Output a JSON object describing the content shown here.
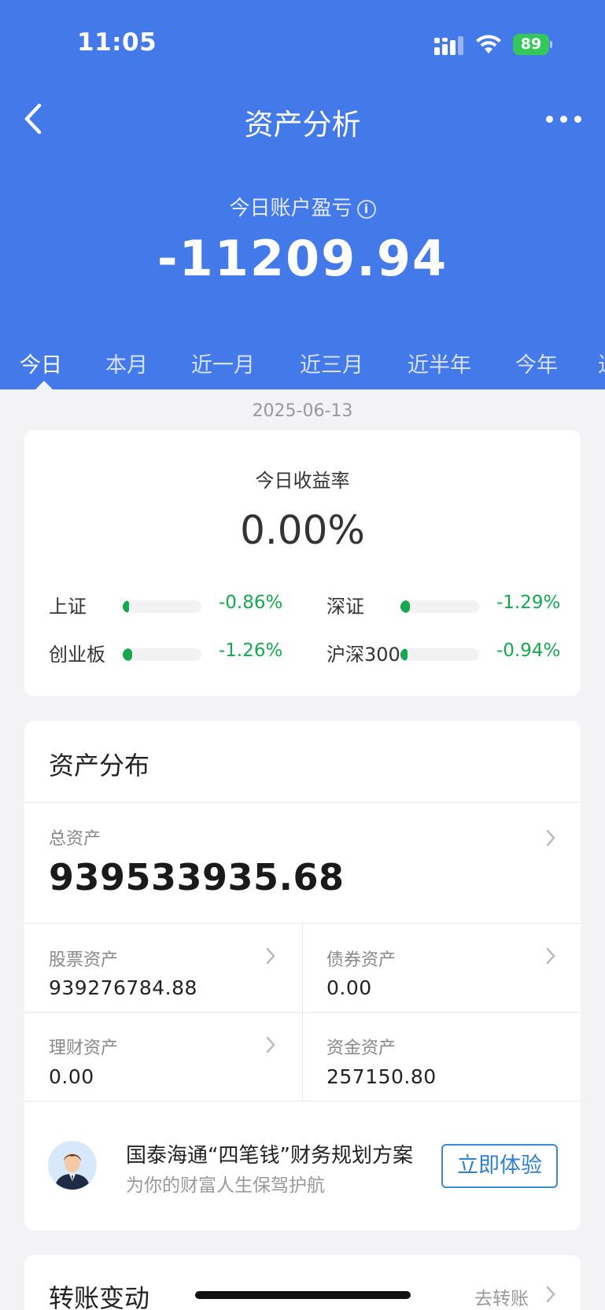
{
  "status_bar": {
    "time": "11:05",
    "battery": "89"
  },
  "nav": {
    "title": "资产分析"
  },
  "pl": {
    "label": "今日账户盈亏",
    "value": "-11209.94"
  },
  "tabs": [
    "今日",
    "本月",
    "近一月",
    "近三月",
    "近半年",
    "今年",
    "近"
  ],
  "date": "2025-06-13",
  "rate_card": {
    "label": "今日收益率",
    "value": "0.00%",
    "indices": [
      {
        "name": "上证",
        "value": "-0.86%",
        "bar_fraction": 0.08
      },
      {
        "name": "深证",
        "value": "-1.29%",
        "bar_fraction": 0.12
      },
      {
        "name": "创业板",
        "value": "-1.26%",
        "bar_fraction": 0.12
      },
      {
        "name": "沪深300",
        "value": "-0.94%",
        "bar_fraction": 0.09
      }
    ],
    "index_color": "#16a750"
  },
  "assets": {
    "title": "资产分布",
    "total_label": "总资产",
    "total_value": "939533935.68",
    "stock_label": "股票资产",
    "stock_value": "939276784.88",
    "bond_label": "债券资产",
    "bond_value": "0.00",
    "wealth_label": "理财资产",
    "wealth_value": "0.00",
    "cash_label": "资金资产",
    "cash_value": "257150.80"
  },
  "promo": {
    "title": "国泰海通“四笔钱”财务规划方案",
    "subtitle": "为你的财富人生保驾护航",
    "button": "立即体验"
  },
  "transfer": {
    "title": "转账变动",
    "link": "去转账"
  },
  "colors": {
    "header": "#4479ea",
    "accent": "#2f7fd2",
    "down": "#16a750"
  }
}
